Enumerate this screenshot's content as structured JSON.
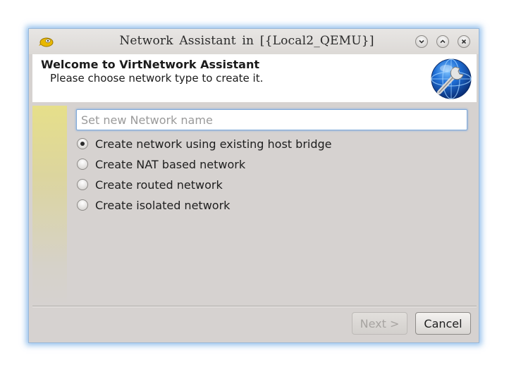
{
  "window": {
    "title": "Network Assistant  in  [{Local2_QEMU}]",
    "controls": [
      "minimize-icon",
      "maximize-icon",
      "close-icon"
    ]
  },
  "header": {
    "title": "Welcome to VirtNetwork Assistant",
    "subtitle": "Please choose network type to create it.",
    "logo_icon": "globe-wrench-icon"
  },
  "form": {
    "name_placeholder": "Set new Network name",
    "name_value": "",
    "options": [
      {
        "label": "Create network using existing host bridge",
        "checked": true
      },
      {
        "label": "Create NAT based network",
        "checked": false
      },
      {
        "label": "Create routed network",
        "checked": false
      },
      {
        "label": "Create isolated network",
        "checked": false
      }
    ]
  },
  "buttons": {
    "next_label": "Next >",
    "next_enabled": false,
    "cancel_label": "Cancel"
  },
  "colors": {
    "accent_focus": "#7fa9d8",
    "window_bg": "#d6d2d0",
    "header_bg": "#ffffff",
    "side_strip": "#e6df8a"
  }
}
